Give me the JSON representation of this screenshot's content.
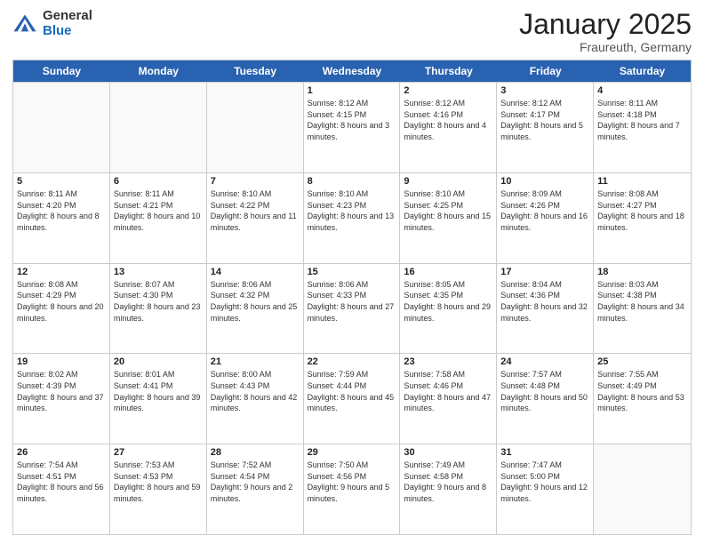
{
  "logo": {
    "general": "General",
    "blue": "Blue"
  },
  "header": {
    "month": "January 2025",
    "location": "Fraureuth, Germany"
  },
  "dayHeaders": [
    "Sunday",
    "Monday",
    "Tuesday",
    "Wednesday",
    "Thursday",
    "Friday",
    "Saturday"
  ],
  "weeks": [
    [
      {
        "day": "",
        "info": ""
      },
      {
        "day": "",
        "info": ""
      },
      {
        "day": "",
        "info": ""
      },
      {
        "day": "1",
        "info": "Sunrise: 8:12 AM\nSunset: 4:15 PM\nDaylight: 8 hours and 3 minutes."
      },
      {
        "day": "2",
        "info": "Sunrise: 8:12 AM\nSunset: 4:16 PM\nDaylight: 8 hours and 4 minutes."
      },
      {
        "day": "3",
        "info": "Sunrise: 8:12 AM\nSunset: 4:17 PM\nDaylight: 8 hours and 5 minutes."
      },
      {
        "day": "4",
        "info": "Sunrise: 8:11 AM\nSunset: 4:18 PM\nDaylight: 8 hours and 7 minutes."
      }
    ],
    [
      {
        "day": "5",
        "info": "Sunrise: 8:11 AM\nSunset: 4:20 PM\nDaylight: 8 hours and 8 minutes."
      },
      {
        "day": "6",
        "info": "Sunrise: 8:11 AM\nSunset: 4:21 PM\nDaylight: 8 hours and 10 minutes."
      },
      {
        "day": "7",
        "info": "Sunrise: 8:10 AM\nSunset: 4:22 PM\nDaylight: 8 hours and 11 minutes."
      },
      {
        "day": "8",
        "info": "Sunrise: 8:10 AM\nSunset: 4:23 PM\nDaylight: 8 hours and 13 minutes."
      },
      {
        "day": "9",
        "info": "Sunrise: 8:10 AM\nSunset: 4:25 PM\nDaylight: 8 hours and 15 minutes."
      },
      {
        "day": "10",
        "info": "Sunrise: 8:09 AM\nSunset: 4:26 PM\nDaylight: 8 hours and 16 minutes."
      },
      {
        "day": "11",
        "info": "Sunrise: 8:08 AM\nSunset: 4:27 PM\nDaylight: 8 hours and 18 minutes."
      }
    ],
    [
      {
        "day": "12",
        "info": "Sunrise: 8:08 AM\nSunset: 4:29 PM\nDaylight: 8 hours and 20 minutes."
      },
      {
        "day": "13",
        "info": "Sunrise: 8:07 AM\nSunset: 4:30 PM\nDaylight: 8 hours and 23 minutes."
      },
      {
        "day": "14",
        "info": "Sunrise: 8:06 AM\nSunset: 4:32 PM\nDaylight: 8 hours and 25 minutes."
      },
      {
        "day": "15",
        "info": "Sunrise: 8:06 AM\nSunset: 4:33 PM\nDaylight: 8 hours and 27 minutes."
      },
      {
        "day": "16",
        "info": "Sunrise: 8:05 AM\nSunset: 4:35 PM\nDaylight: 8 hours and 29 minutes."
      },
      {
        "day": "17",
        "info": "Sunrise: 8:04 AM\nSunset: 4:36 PM\nDaylight: 8 hours and 32 minutes."
      },
      {
        "day": "18",
        "info": "Sunrise: 8:03 AM\nSunset: 4:38 PM\nDaylight: 8 hours and 34 minutes."
      }
    ],
    [
      {
        "day": "19",
        "info": "Sunrise: 8:02 AM\nSunset: 4:39 PM\nDaylight: 8 hours and 37 minutes."
      },
      {
        "day": "20",
        "info": "Sunrise: 8:01 AM\nSunset: 4:41 PM\nDaylight: 8 hours and 39 minutes."
      },
      {
        "day": "21",
        "info": "Sunrise: 8:00 AM\nSunset: 4:43 PM\nDaylight: 8 hours and 42 minutes."
      },
      {
        "day": "22",
        "info": "Sunrise: 7:59 AM\nSunset: 4:44 PM\nDaylight: 8 hours and 45 minutes."
      },
      {
        "day": "23",
        "info": "Sunrise: 7:58 AM\nSunset: 4:46 PM\nDaylight: 8 hours and 47 minutes."
      },
      {
        "day": "24",
        "info": "Sunrise: 7:57 AM\nSunset: 4:48 PM\nDaylight: 8 hours and 50 minutes."
      },
      {
        "day": "25",
        "info": "Sunrise: 7:55 AM\nSunset: 4:49 PM\nDaylight: 8 hours and 53 minutes."
      }
    ],
    [
      {
        "day": "26",
        "info": "Sunrise: 7:54 AM\nSunset: 4:51 PM\nDaylight: 8 hours and 56 minutes."
      },
      {
        "day": "27",
        "info": "Sunrise: 7:53 AM\nSunset: 4:53 PM\nDaylight: 8 hours and 59 minutes."
      },
      {
        "day": "28",
        "info": "Sunrise: 7:52 AM\nSunset: 4:54 PM\nDaylight: 9 hours and 2 minutes."
      },
      {
        "day": "29",
        "info": "Sunrise: 7:50 AM\nSunset: 4:56 PM\nDaylight: 9 hours and 5 minutes."
      },
      {
        "day": "30",
        "info": "Sunrise: 7:49 AM\nSunset: 4:58 PM\nDaylight: 9 hours and 8 minutes."
      },
      {
        "day": "31",
        "info": "Sunrise: 7:47 AM\nSunset: 5:00 PM\nDaylight: 9 hours and 12 minutes."
      },
      {
        "day": "",
        "info": ""
      }
    ]
  ]
}
